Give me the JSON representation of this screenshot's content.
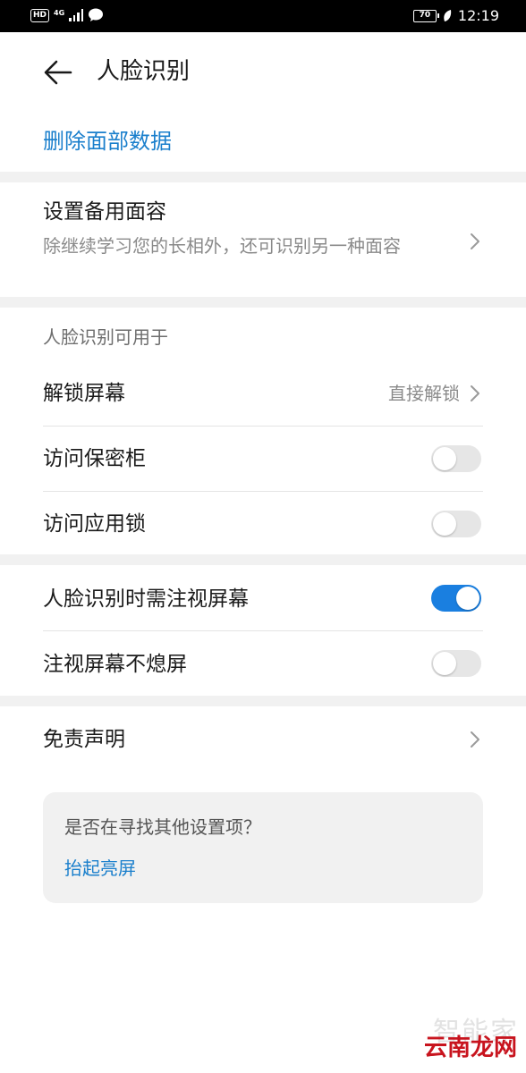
{
  "status_bar": {
    "hd": "HD",
    "network": "4G",
    "battery": "70",
    "time": "12:19"
  },
  "header": {
    "title": "人脸识别"
  },
  "actions": {
    "delete_label": "删除面部数据"
  },
  "alt_face": {
    "title": "设置备用面容",
    "subtitle": "除继续学习您的长相外，还可识别另一种面容"
  },
  "usage": {
    "section_title": "人脸识别可用于",
    "items": [
      {
        "label": "解锁屏幕",
        "value": "直接解锁"
      },
      {
        "label": "访问保密柜",
        "enabled": false
      },
      {
        "label": "访问应用锁",
        "enabled": false
      }
    ]
  },
  "attention": {
    "items": [
      {
        "label": "人脸识别时需注视屏幕",
        "enabled": true
      },
      {
        "label": "注视屏幕不熄屏",
        "enabled": false
      }
    ]
  },
  "disclaimer": {
    "label": "免责声明"
  },
  "suggestion": {
    "question": "是否在寻找其他设置项？",
    "link": "抬起亮屏"
  },
  "watermark": {
    "top": "智能家",
    "bottom": "云南龙网"
  },
  "colors": {
    "accent": "#1a7fcc",
    "toggle_on": "#1a7fe0",
    "toggle_off": "#e6e6e6",
    "band": "#f1f1f1"
  },
  "icons": {
    "back": "arrow-left-icon",
    "chevron": "chevron-right-icon",
    "wechat": "chat-bubble-icon"
  }
}
